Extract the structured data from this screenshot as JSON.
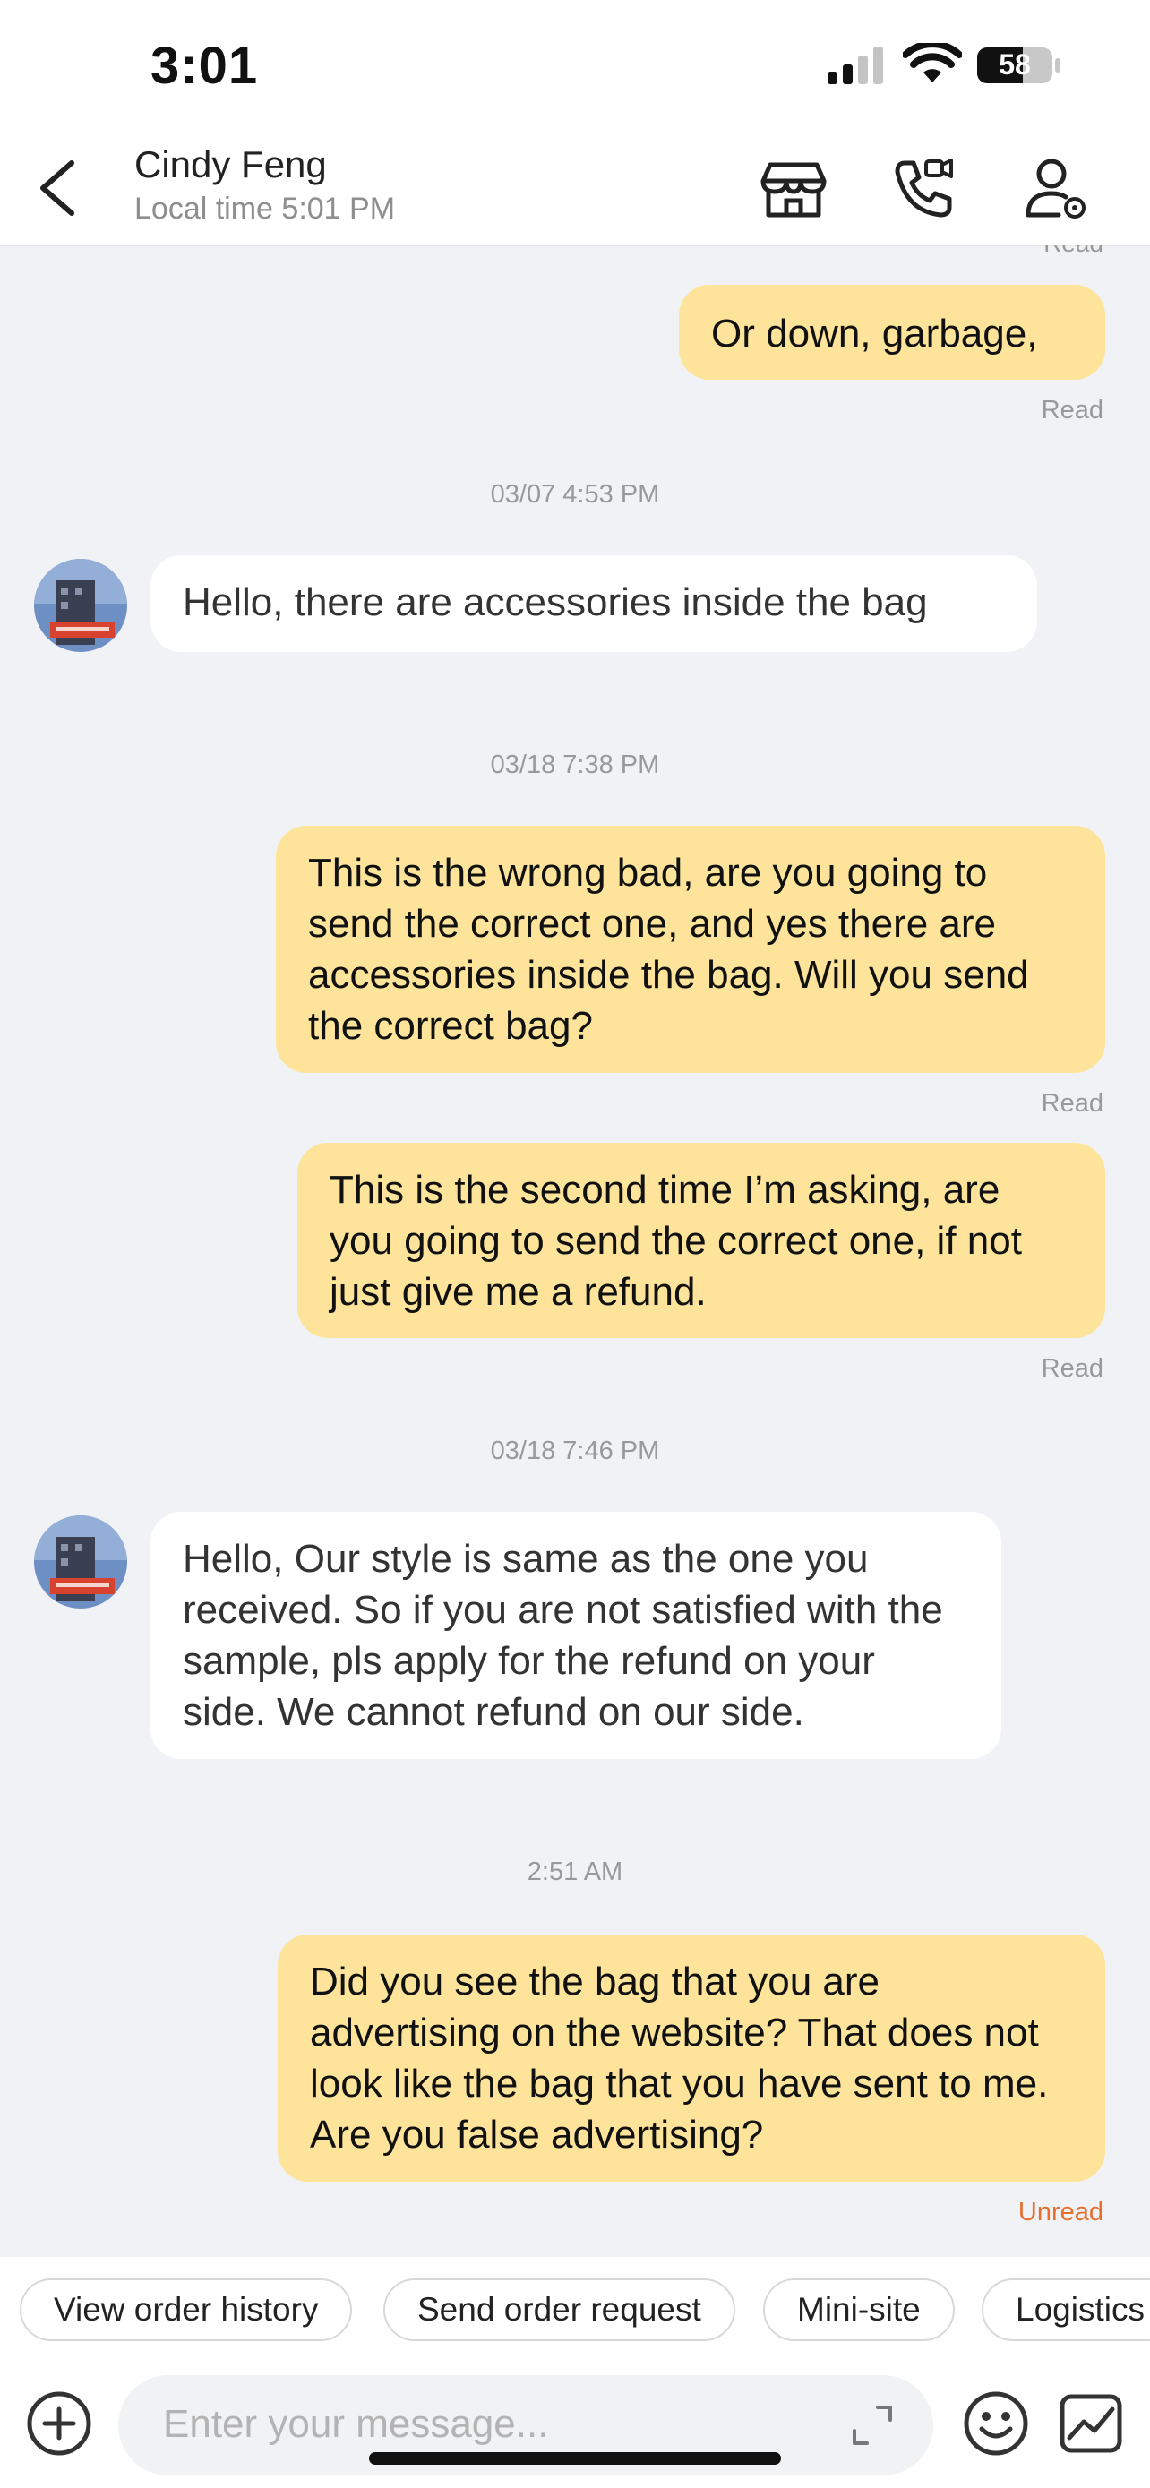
{
  "status_bar": {
    "time": "3:01",
    "battery": "58"
  },
  "header": {
    "contact_name": "Cindy Feng",
    "local_time": "Local time 5:01 PM",
    "icons": [
      "back-chevron-icon",
      "store-icon",
      "video-call-icon",
      "contact-profile-icon"
    ]
  },
  "messages": [
    {
      "id": "m0",
      "direction": "out",
      "status": "Read"
    },
    {
      "id": "m1",
      "direction": "out",
      "text": "Or down, garbage,",
      "status": "Read"
    },
    {
      "id": "t1",
      "timestamp": "03/07 4:53 PM"
    },
    {
      "id": "m2",
      "direction": "in",
      "text": "Hello, there are accessories inside the bag"
    },
    {
      "id": "t2",
      "timestamp": "03/18 7:38 PM"
    },
    {
      "id": "m3",
      "direction": "out",
      "text": "This is the wrong bad, are you going to send the correct one, and yes there are accessories inside the bag. Will you send the correct bag?",
      "status": "Read"
    },
    {
      "id": "m4",
      "direction": "out",
      "text": "This is the second time I’m asking, are you going to send the correct one, if not just give me a refund.",
      "status": "Read"
    },
    {
      "id": "t3",
      "timestamp": "03/18 7:46 PM"
    },
    {
      "id": "m5",
      "direction": "in",
      "text": "Hello, Our style is same as the one you received. So if you are not satisfied with the sample, pls apply for the refund on your side. We cannot refund on our side."
    },
    {
      "id": "t4",
      "timestamp": "2:51 AM"
    },
    {
      "id": "m6",
      "direction": "out",
      "text": "Did you see the bag that you are advertising on the website? That does not look like the bag that you have sent to me. Are you false advertising?",
      "status": "Unread"
    }
  ],
  "quick_actions": [
    "View order history",
    "Send order request",
    "Mini-site",
    "Logistics"
  ],
  "composer": {
    "placeholder": "Enter your message...",
    "icons": [
      "plus-icon",
      "expand-icon",
      "emoji-icon",
      "sticker-icon"
    ]
  },
  "colors": {
    "outgoing_bubble": "#fde49a",
    "incoming_bubble": "#ffffff",
    "chat_background": "#f1f2f6",
    "unread": "#e6702e"
  }
}
